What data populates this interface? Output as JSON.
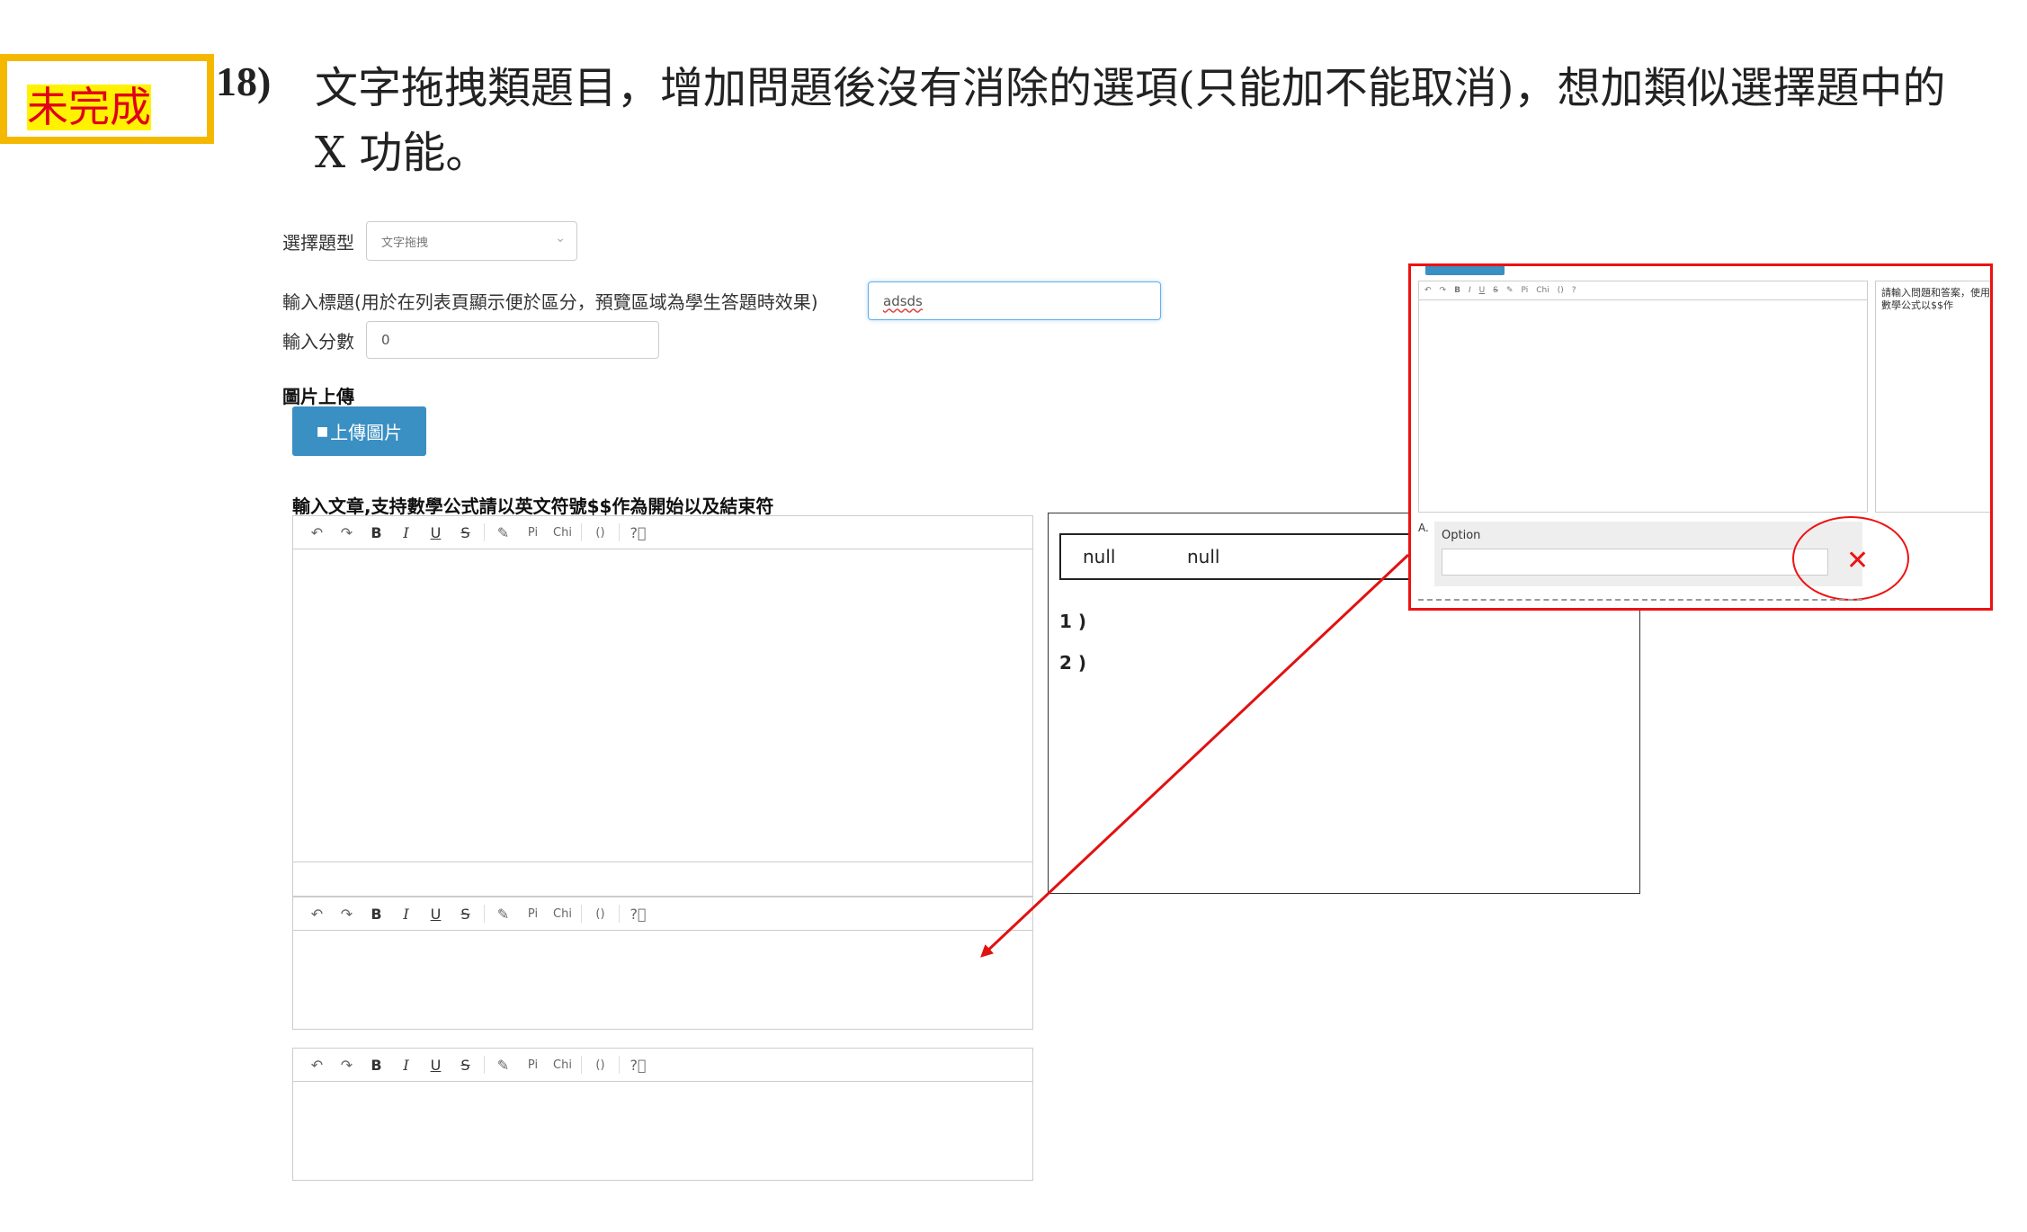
{
  "status_badge": "未完成",
  "question": {
    "number": "18)",
    "text": "文字拖拽類題目，增加問題後沒有消除的選項(只能加不能取消)，想加類似選擇題中的 X 功能。"
  },
  "form": {
    "type_label": "選擇題型",
    "type_value": "文字拖拽",
    "title_label": "輸入標題(用於在列表頁顯示便於區分，預覽區域為學生答題時效果)",
    "title_value": "adsds",
    "score_label": "輸入分數",
    "score_value": "0",
    "image_section_label": "圖片上傳",
    "upload_button": "上傳圖片",
    "article_label": "輸入文章,支持數學公式請以英文符號$$作為開始以及結束符"
  },
  "toolbar": {
    "undo_icon": "undo-icon",
    "redo_icon": "redo-icon",
    "bold": "B",
    "italic": "I",
    "underline": "U",
    "strike": "S",
    "pen_icon": "pen-icon",
    "pi": "Pi",
    "chi": "Chi",
    "paren": "()",
    "help_icon": "help-circle-icon"
  },
  "preview": {
    "options": [
      "null",
      "null"
    ],
    "answers": [
      "1 )",
      "2 )"
    ]
  },
  "inset": {
    "help_text": "請輸入問題和答案，使用數學公式以$$作",
    "option_prefix": "A.",
    "option_label": "Option",
    "delete_symbol": "✕"
  },
  "colors": {
    "badge_border": "#f5b800",
    "badge_text": "#e0001b",
    "badge_highlight": "#fff200",
    "upload_button": "#3a8fc3",
    "annotation_red": "#e11111"
  }
}
